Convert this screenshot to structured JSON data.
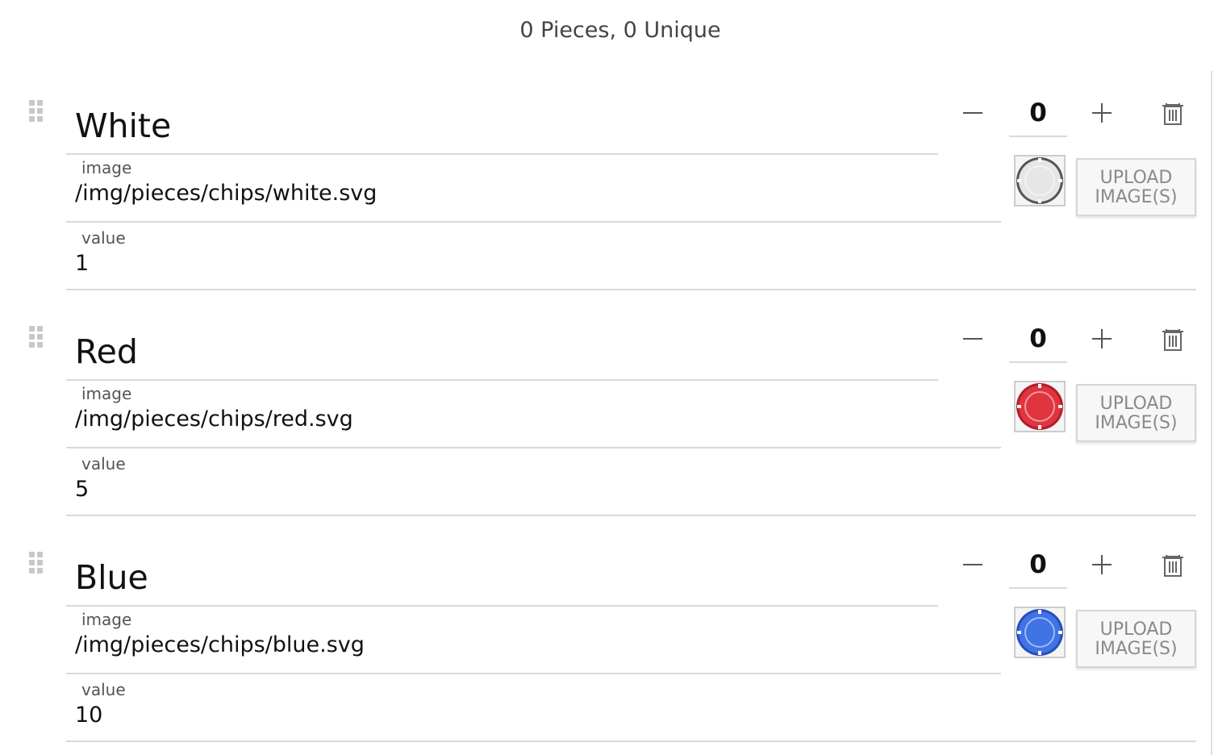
{
  "summary": "0 Pieces, 0 Unique",
  "image_label": "image",
  "value_label": "value",
  "upload_label": "UPLOAD IMAGE(S)",
  "pieces": [
    {
      "name": "White",
      "count": "0",
      "image": "/img/pieces/chips/white.svg",
      "value": "1",
      "color": "#e6e6e6",
      "rim": "#555555"
    },
    {
      "name": "Red",
      "count": "0",
      "image": "/img/pieces/chips/red.svg",
      "value": "5",
      "color": "#e0343f",
      "rim": "#b01e28"
    },
    {
      "name": "Blue",
      "count": "0",
      "image": "/img/pieces/chips/blue.svg",
      "value": "10",
      "color": "#3f73e6",
      "rim": "#274fb5"
    }
  ]
}
